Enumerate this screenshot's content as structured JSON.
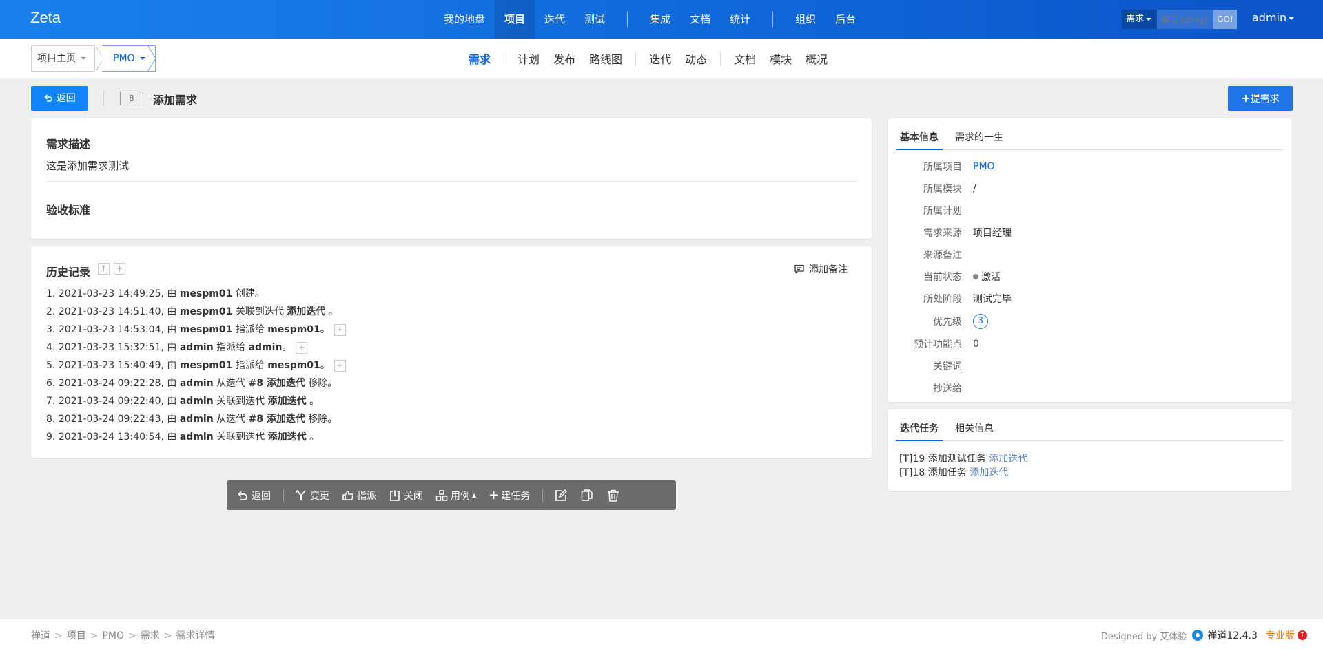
{
  "header": {
    "brand": "Zeta",
    "nav": [
      "我的地盘",
      "项目",
      "迭代",
      "测试",
      "集成",
      "文档",
      "统计",
      "组织",
      "后台"
    ],
    "search_type": "需求",
    "search_placeholder": "编号(ctrl+g)",
    "search_go": "GO!",
    "user": "admin"
  },
  "subnav": {
    "crumb_home": "项目主页",
    "crumb_project": "PMO",
    "items": [
      "需求",
      "计划",
      "发布",
      "路线图",
      "迭代",
      "动态",
      "文档",
      "模块",
      "概况"
    ]
  },
  "titlebar": {
    "back_label": "返回",
    "id": "8",
    "title": "添加需求",
    "create_label": "提需求"
  },
  "description": {
    "title": "需求描述",
    "text": "这是添加需求测试",
    "acceptance_title": "验收标准"
  },
  "history": {
    "title": "历史记录",
    "add_note": "添加备注",
    "entries": [
      {
        "n": "1.",
        "time": "2021-03-23 14:49:25, 由",
        "user": "mespm01",
        "action": "创建。"
      },
      {
        "n": "2.",
        "time": "2021-03-23 14:51:40, 由",
        "user": "mespm01",
        "action": "关联到迭代",
        "target": "添加迭代",
        "tail": "。"
      },
      {
        "n": "3.",
        "time": "2021-03-23 14:53:04, 由",
        "user": "mespm01",
        "action": "指派给",
        "target": "mespm01",
        "tail": "。"
      },
      {
        "n": "4.",
        "time": "2021-03-23 15:32:51, 由",
        "user": "admin",
        "action": "指派给",
        "target": "admin",
        "tail": "。"
      },
      {
        "n": "5.",
        "time": "2021-03-23 15:40:49, 由",
        "user": "mespm01",
        "action": "指派给",
        "target": "mespm01",
        "tail": "。"
      },
      {
        "n": "6.",
        "time": "2021-03-24 09:22:28, 由",
        "user": "admin",
        "action": "从迭代",
        "target": "#8 添加迭代",
        "tail": "移除。"
      },
      {
        "n": "7.",
        "time": "2021-03-24 09:22:40, 由",
        "user": "admin",
        "action": "关联到迭代",
        "target": "添加迭代",
        "tail": "。"
      },
      {
        "n": "8.",
        "time": "2021-03-24 09:22:43, 由",
        "user": "admin",
        "action": "从迭代",
        "target": "#8 添加迭代",
        "tail": "移除。"
      },
      {
        "n": "9.",
        "time": "2021-03-24 13:40:54, 由",
        "user": "admin",
        "action": "关联到迭代",
        "target": "添加迭代",
        "tail": "。"
      }
    ]
  },
  "actions": {
    "back": "返回",
    "change": "变更",
    "assign": "指派",
    "close": "关闭",
    "cases": "用例",
    "create_task": "建任务"
  },
  "basic_info": {
    "tabs": [
      "基本信息",
      "需求的一生"
    ],
    "rows": [
      {
        "label": "所属项目",
        "value": "PMO"
      },
      {
        "label": "所属模块",
        "value": "/"
      },
      {
        "label": "所属计划",
        "value": ""
      },
      {
        "label": "需求来源",
        "value": "项目经理"
      },
      {
        "label": "来源备注",
        "value": ""
      },
      {
        "label": "当前状态",
        "value": "激活"
      },
      {
        "label": "所处阶段",
        "value": "测试完毕"
      },
      {
        "label": "优先级",
        "value": "3"
      },
      {
        "label": "预计功能点",
        "value": "0"
      },
      {
        "label": "关键词",
        "value": ""
      },
      {
        "label": "抄送给",
        "value": ""
      }
    ]
  },
  "tasks": {
    "tabs": [
      "迭代任务",
      "相关信息"
    ],
    "items": [
      {
        "text": "[T]19 添加测试任务",
        "link": "添加迭代"
      },
      {
        "text": "[T]18 添加任务",
        "link": "添加迭代"
      }
    ]
  },
  "footer": {
    "crumbs": [
      "禅道",
      "项目",
      "PMO",
      "需求",
      "需求详情"
    ],
    "designed_by": "Designed by 艾体验",
    "version": "禅道12.4.3",
    "edition": "专业版"
  },
  "colors": {
    "primary": "#1183fb",
    "header": "#0f65d6",
    "link": "#0c64eb"
  }
}
